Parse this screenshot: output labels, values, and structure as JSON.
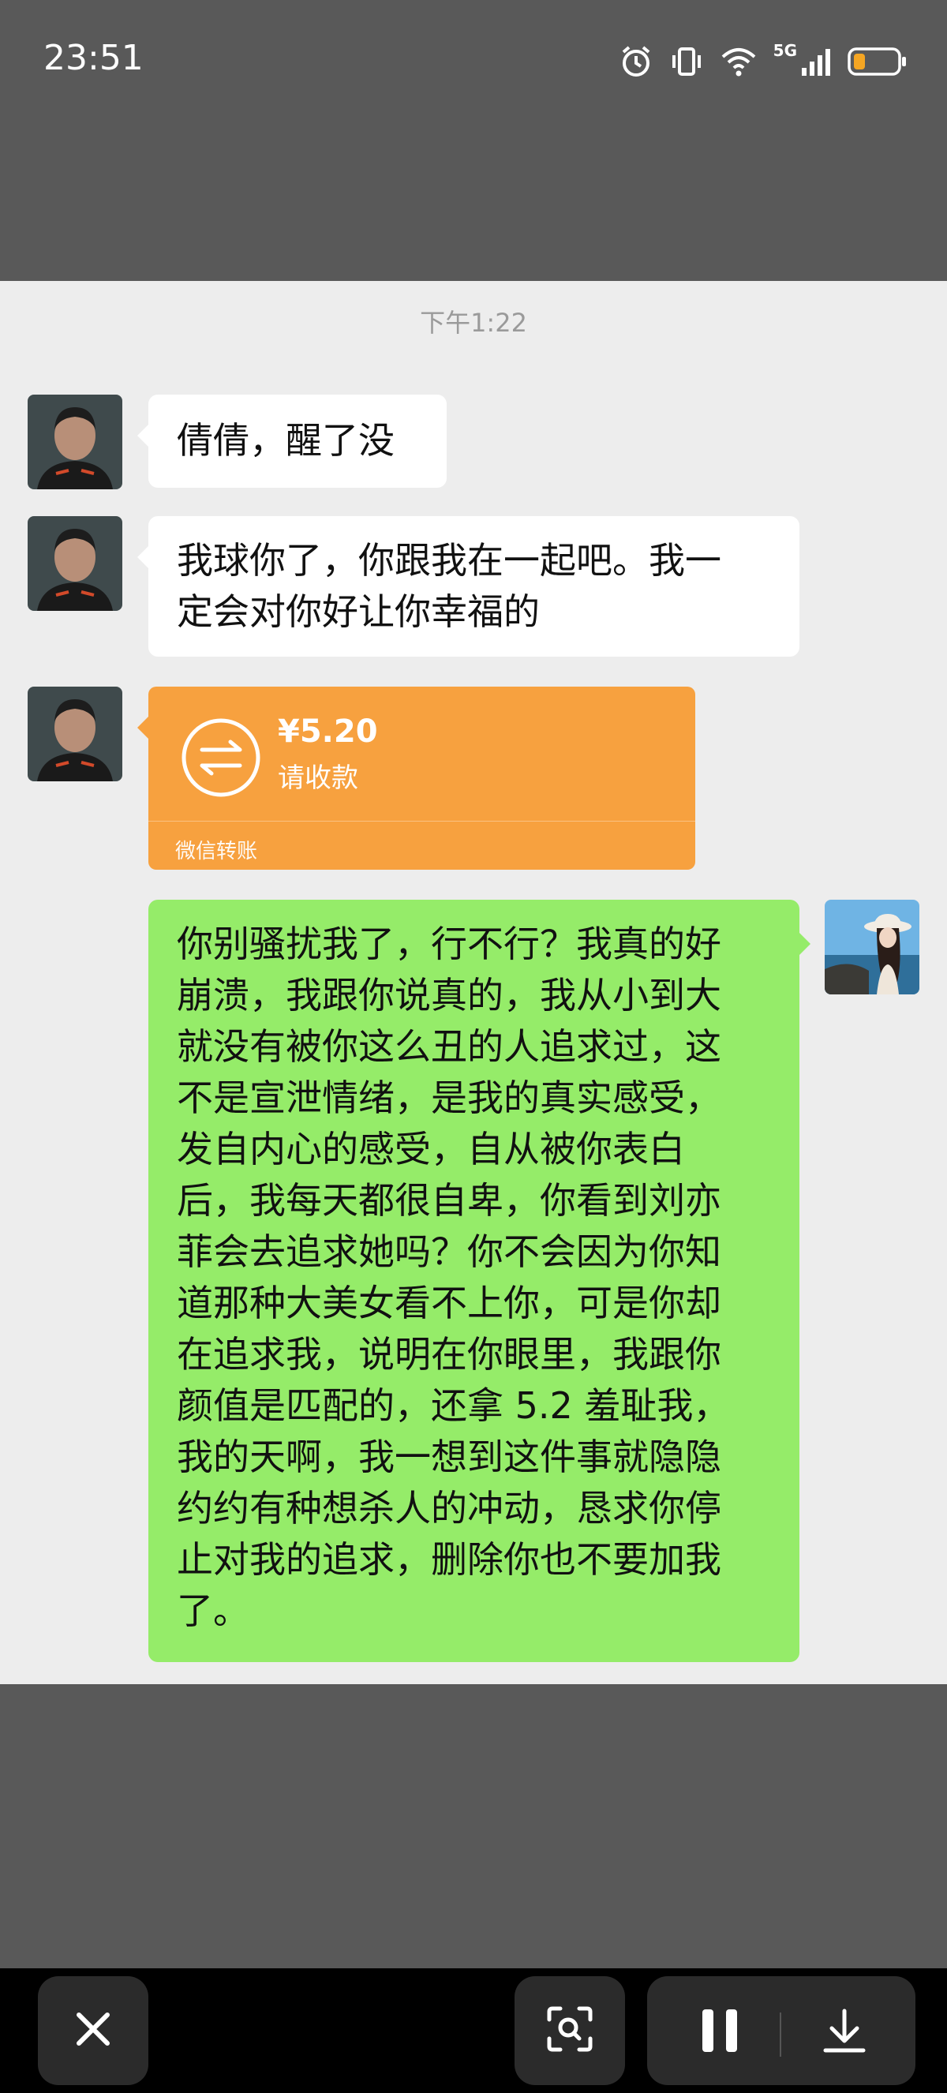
{
  "status_bar": {
    "time": "23:51",
    "network": "5G",
    "icons": [
      "alarm-icon",
      "vibrate-icon",
      "wifi-icon",
      "signal-icon",
      "battery-icon"
    ]
  },
  "chat": {
    "timestamp": "下午1:22",
    "messages": [
      {
        "sender": "other",
        "type": "text",
        "text": "倩倩，醒了没"
      },
      {
        "sender": "other",
        "type": "text",
        "lines": [
          "我球你了，你跟我在一起吧。我一",
          "定会对你好让你幸福的"
        ]
      },
      {
        "sender": "other",
        "type": "transfer",
        "amount": "¥5.20",
        "status": "请收款",
        "brand": "微信转账"
      },
      {
        "sender": "me",
        "type": "text",
        "lines": [
          "你别骚扰我了，行不行？我真的好",
          "崩溃，我跟你说真的，我从小到大",
          "就没有被你这么丑的人追求过，这",
          "不是宣泄情绪，是我的真实感受，",
          "发自内心的感受，自从被你表白",
          "后，我每天都很自卑，你看到刘亦",
          "菲会去追求她吗？你不会因为你知",
          "道那种大美女看不上你，可是你却",
          "在追求我，说明在你眼里，我跟你",
          "颜值是匹配的，还拿 5.2 羞耻我，",
          "我的天啊，我一想到这件事就隐隐",
          "约约有种想杀人的冲动，恳求你停",
          "止对我的追求，删除你也不要加我",
          "了。"
        ]
      }
    ]
  },
  "colors": {
    "chat_bg": "#ededed",
    "green_bubble": "#95ec69",
    "transfer_orange": "#f7a13f",
    "frame_gray": "#595959"
  },
  "bottom_bar": {
    "buttons": [
      "close-icon",
      "scan-icon",
      "pause-icon",
      "download-icon"
    ]
  }
}
